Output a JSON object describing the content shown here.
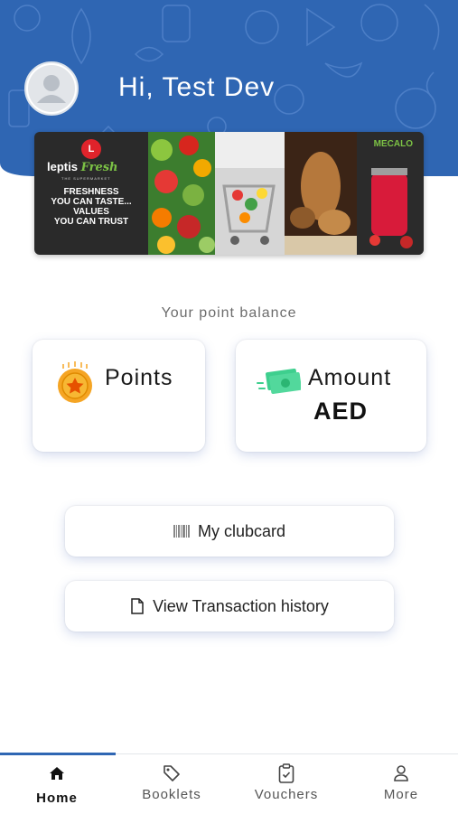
{
  "header": {
    "greeting": "Hi, Test Dev",
    "background_color": "#2f66b3"
  },
  "banner": {
    "brand": "leptis",
    "brand_fresh": "Fresh",
    "brand_sub": "THE SUPERMARKET",
    "tagline_1": "FRESHNESS",
    "tagline_2": "YOU CAN TASTE...",
    "tagline_3": "VALUES",
    "tagline_4": "YOU CAN TRUST",
    "partner": "MECALO"
  },
  "balance": {
    "label": "Your point balance",
    "points_title": "Points",
    "amount_title": "Amount",
    "amount_currency": "AED"
  },
  "actions": {
    "clubcard_label": "My clubcard",
    "history_label": "View Transaction history"
  },
  "tabs": [
    {
      "label": "Home",
      "icon": "home-icon",
      "active": true
    },
    {
      "label": "Booklets",
      "icon": "tag-icon",
      "active": false
    },
    {
      "label": "Vouchers",
      "icon": "clipboard-check-icon",
      "active": false
    },
    {
      "label": "More",
      "icon": "person-icon",
      "active": false
    }
  ],
  "colors": {
    "accent": "#2f66b3",
    "coin": "#f5a524",
    "money": "#3ecf8e"
  }
}
